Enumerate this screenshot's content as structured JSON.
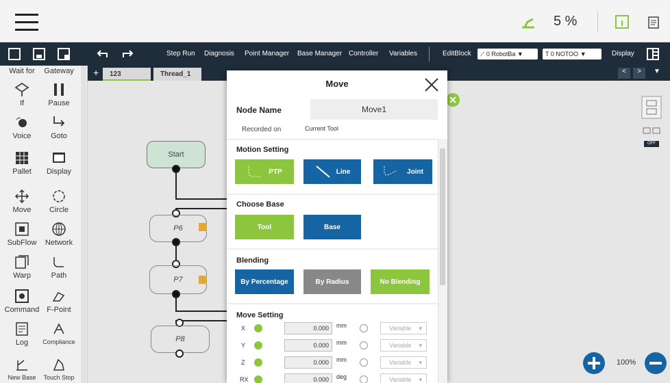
{
  "topbar": {
    "speed_percent": "5 %"
  },
  "toolbar": {
    "step_run": "Step Run",
    "diagnosis": "Diagnosis",
    "point_manager": "Point Manager",
    "base_manager": "Base Manager",
    "controller": "Controller",
    "variables": "Variables",
    "edit_block": "EditBlock",
    "robot_base": "0 RobotBa",
    "tool_select": "0 NOTOO",
    "display": "Display"
  },
  "sidebar": {
    "items": [
      {
        "label": "Wait for"
      },
      {
        "label": "Gateway"
      },
      {
        "label": "If"
      },
      {
        "label": "Pause"
      },
      {
        "label": "Voice"
      },
      {
        "label": "Goto"
      },
      {
        "label": "Pallet"
      },
      {
        "label": "Display"
      },
      {
        "label": "Move"
      },
      {
        "label": "Circle"
      },
      {
        "label": "SubFlow"
      },
      {
        "label": "Network"
      },
      {
        "label": "Warp"
      },
      {
        "label": "Path"
      },
      {
        "label": "Command"
      },
      {
        "label": "F-Point"
      },
      {
        "label": "Log"
      },
      {
        "label": "Compliance"
      },
      {
        "label": "New Base"
      },
      {
        "label": "Touch Stop"
      }
    ]
  },
  "tabs": [
    "123",
    "Thread_1"
  ],
  "canvas": {
    "start": "Start",
    "p6": "P6",
    "p7": "P7",
    "p8": "P8",
    "zoom": "100%",
    "toggle": "OFF"
  },
  "modal": {
    "title": "Move",
    "node_name_label": "Node Name",
    "node_name_value": "Move1",
    "recorded_label": "Recorded on",
    "recorded_value": "Current Tool",
    "motion_setting": "Motion Setting",
    "motion_buttons": [
      "PTP",
      "Line",
      "Joint"
    ],
    "choose_base": "Choose Base",
    "base_buttons": [
      "Tool",
      "Base"
    ],
    "blending": "Blending",
    "blending_buttons": [
      "By Percentage",
      "By Radius",
      "No Blending"
    ],
    "move_setting": "Move Setting",
    "rows": [
      {
        "axis": "X",
        "value": "0.000",
        "unit": "mm",
        "variable": "Variable"
      },
      {
        "axis": "Y",
        "value": "0.000",
        "unit": "mm",
        "variable": "Variable"
      },
      {
        "axis": "Z",
        "value": "0.000",
        "unit": "mm",
        "variable": "Variable"
      },
      {
        "axis": "RX",
        "value": "0.000",
        "unit": "deg",
        "variable": "Variable"
      }
    ]
  },
  "colors": {
    "green": "#8cc63f",
    "blue": "#1565a5",
    "grey": "#888888",
    "navy": "#1f2d3a"
  }
}
